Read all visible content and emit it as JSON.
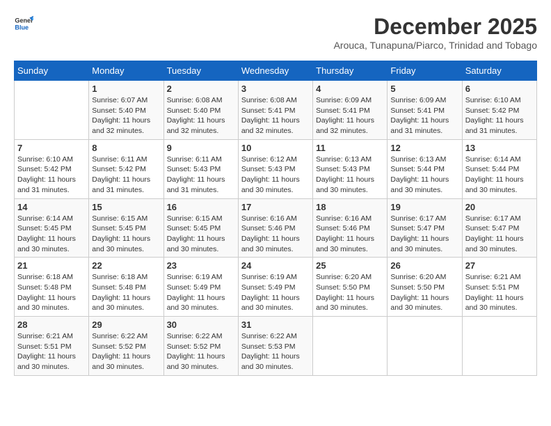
{
  "header": {
    "logo_general": "General",
    "logo_blue": "Blue",
    "month_title": "December 2025",
    "subtitle": "Arouca, Tunapuna/Piarco, Trinidad and Tobago"
  },
  "weekdays": [
    "Sunday",
    "Monday",
    "Tuesday",
    "Wednesday",
    "Thursday",
    "Friday",
    "Saturday"
  ],
  "weeks": [
    [
      {
        "day": "",
        "info": ""
      },
      {
        "day": "1",
        "info": "Sunrise: 6:07 AM\nSunset: 5:40 PM\nDaylight: 11 hours\nand 32 minutes."
      },
      {
        "day": "2",
        "info": "Sunrise: 6:08 AM\nSunset: 5:40 PM\nDaylight: 11 hours\nand 32 minutes."
      },
      {
        "day": "3",
        "info": "Sunrise: 6:08 AM\nSunset: 5:41 PM\nDaylight: 11 hours\nand 32 minutes."
      },
      {
        "day": "4",
        "info": "Sunrise: 6:09 AM\nSunset: 5:41 PM\nDaylight: 11 hours\nand 32 minutes."
      },
      {
        "day": "5",
        "info": "Sunrise: 6:09 AM\nSunset: 5:41 PM\nDaylight: 11 hours\nand 31 minutes."
      },
      {
        "day": "6",
        "info": "Sunrise: 6:10 AM\nSunset: 5:42 PM\nDaylight: 11 hours\nand 31 minutes."
      }
    ],
    [
      {
        "day": "7",
        "info": "Sunrise: 6:10 AM\nSunset: 5:42 PM\nDaylight: 11 hours\nand 31 minutes."
      },
      {
        "day": "8",
        "info": "Sunrise: 6:11 AM\nSunset: 5:42 PM\nDaylight: 11 hours\nand 31 minutes."
      },
      {
        "day": "9",
        "info": "Sunrise: 6:11 AM\nSunset: 5:43 PM\nDaylight: 11 hours\nand 31 minutes."
      },
      {
        "day": "10",
        "info": "Sunrise: 6:12 AM\nSunset: 5:43 PM\nDaylight: 11 hours\nand 30 minutes."
      },
      {
        "day": "11",
        "info": "Sunrise: 6:13 AM\nSunset: 5:43 PM\nDaylight: 11 hours\nand 30 minutes."
      },
      {
        "day": "12",
        "info": "Sunrise: 6:13 AM\nSunset: 5:44 PM\nDaylight: 11 hours\nand 30 minutes."
      },
      {
        "day": "13",
        "info": "Sunrise: 6:14 AM\nSunset: 5:44 PM\nDaylight: 11 hours\nand 30 minutes."
      }
    ],
    [
      {
        "day": "14",
        "info": "Sunrise: 6:14 AM\nSunset: 5:45 PM\nDaylight: 11 hours\nand 30 minutes."
      },
      {
        "day": "15",
        "info": "Sunrise: 6:15 AM\nSunset: 5:45 PM\nDaylight: 11 hours\nand 30 minutes."
      },
      {
        "day": "16",
        "info": "Sunrise: 6:15 AM\nSunset: 5:45 PM\nDaylight: 11 hours\nand 30 minutes."
      },
      {
        "day": "17",
        "info": "Sunrise: 6:16 AM\nSunset: 5:46 PM\nDaylight: 11 hours\nand 30 minutes."
      },
      {
        "day": "18",
        "info": "Sunrise: 6:16 AM\nSunset: 5:46 PM\nDaylight: 11 hours\nand 30 minutes."
      },
      {
        "day": "19",
        "info": "Sunrise: 6:17 AM\nSunset: 5:47 PM\nDaylight: 11 hours\nand 30 minutes."
      },
      {
        "day": "20",
        "info": "Sunrise: 6:17 AM\nSunset: 5:47 PM\nDaylight: 11 hours\nand 30 minutes."
      }
    ],
    [
      {
        "day": "21",
        "info": "Sunrise: 6:18 AM\nSunset: 5:48 PM\nDaylight: 11 hours\nand 30 minutes."
      },
      {
        "day": "22",
        "info": "Sunrise: 6:18 AM\nSunset: 5:48 PM\nDaylight: 11 hours\nand 30 minutes."
      },
      {
        "day": "23",
        "info": "Sunrise: 6:19 AM\nSunset: 5:49 PM\nDaylight: 11 hours\nand 30 minutes."
      },
      {
        "day": "24",
        "info": "Sunrise: 6:19 AM\nSunset: 5:49 PM\nDaylight: 11 hours\nand 30 minutes."
      },
      {
        "day": "25",
        "info": "Sunrise: 6:20 AM\nSunset: 5:50 PM\nDaylight: 11 hours\nand 30 minutes."
      },
      {
        "day": "26",
        "info": "Sunrise: 6:20 AM\nSunset: 5:50 PM\nDaylight: 11 hours\nand 30 minutes."
      },
      {
        "day": "27",
        "info": "Sunrise: 6:21 AM\nSunset: 5:51 PM\nDaylight: 11 hours\nand 30 minutes."
      }
    ],
    [
      {
        "day": "28",
        "info": "Sunrise: 6:21 AM\nSunset: 5:51 PM\nDaylight: 11 hours\nand 30 minutes."
      },
      {
        "day": "29",
        "info": "Sunrise: 6:22 AM\nSunset: 5:52 PM\nDaylight: 11 hours\nand 30 minutes."
      },
      {
        "day": "30",
        "info": "Sunrise: 6:22 AM\nSunset: 5:52 PM\nDaylight: 11 hours\nand 30 minutes."
      },
      {
        "day": "31",
        "info": "Sunrise: 6:22 AM\nSunset: 5:53 PM\nDaylight: 11 hours\nand 30 minutes."
      },
      {
        "day": "",
        "info": ""
      },
      {
        "day": "",
        "info": ""
      },
      {
        "day": "",
        "info": ""
      }
    ]
  ]
}
